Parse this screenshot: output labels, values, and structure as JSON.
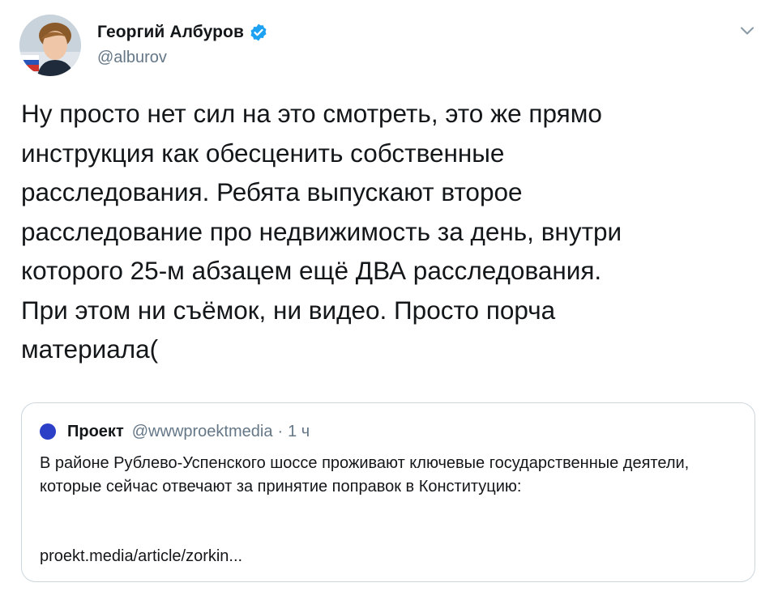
{
  "tweet": {
    "author": {
      "display_name": "Георгий Албуров",
      "handle": "@alburov",
      "verified": true
    },
    "text": "Ну просто нет сил на это смотреть, это же прямо\nинструкция как обесценить собственные\nрасследования. Ребята выпускают второе\nрасследование про недвижимость за день, внутри\nкоторого 25-м абзацем ещё ДВА расследования.\nПри этом ни съёмок, ни видео. Просто порча\nматериала(",
    "menu_icon": "chevron-down-icon"
  },
  "quoted_tweet": {
    "author": {
      "display_name": "Проект",
      "handle": "@wwwproektmedia",
      "separator": "·",
      "time": "1 ч"
    },
    "text": "В районе Рублево-Успенского шоссе проживают ключевые государственные деятели, которые сейчас отвечают за принятие поправок в Конституцию:",
    "link": "proekt.media/article/zorkin..."
  },
  "colors": {
    "text_primary": "#14171a",
    "text_secondary": "#657786",
    "verified_blue": "#1da1f2",
    "border": "#ccd6dd",
    "quote_avatar": "#2b3fc7"
  }
}
